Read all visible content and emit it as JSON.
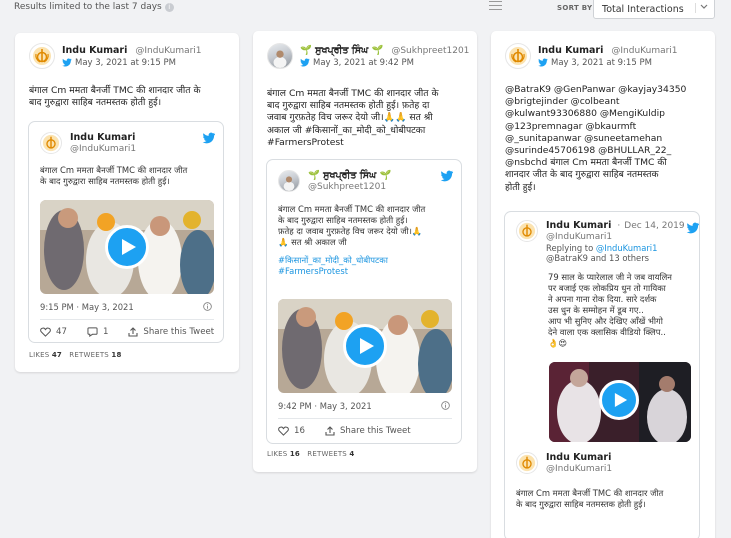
{
  "header": {
    "limit_text": "Results limited to the last 7 days",
    "sort_label": "SORT BY",
    "sort_value": "Total Interactions"
  },
  "colors": {
    "twitter_blue": "#1da1f2",
    "link": "#1b95e0",
    "background": "#f1f2f4"
  },
  "cards": [
    {
      "author": "Indu Kumari",
      "handle": "@InduKumari1",
      "date": "May 3, 2021 at 9:15 PM",
      "text_lines": [
        "बंगाल Cm ममता बैनर्जी TMC की शानदार जीत के",
        "बाद गुरुद्वारा साहिब नतमस्तक होती हुई।"
      ],
      "embed": {
        "author": "Indu Kumari",
        "handle": "@InduKumari1",
        "text_lines": [
          "बंगाल Cm ममता बैनर्जी TMC की शानदार जीत",
          "के बाद गुरुद्वारा साहिब नतमस्तक होती हुई।"
        ],
        "timestamp": "9:15 PM · May 3, 2021",
        "likes": "47",
        "replies": "1",
        "share": "Share this Tweet"
      },
      "stats": {
        "likes_label": "LIKES",
        "likes": "47",
        "retweets_label": "RETWEETS",
        "retweets": "18"
      }
    },
    {
      "author": "🌱 ਸੁਖਪ੍ਰੀਤ ਸਿੰਘ 🌱",
      "handle": "@Sukhpreet1201",
      "date": "May 3, 2021 at 9:42 PM",
      "text_lines": [
        "बंगाल Cm ममता बैनर्जी TMC की शानदार जीत के",
        "बाद गुरुद्वारा साहिब नतमस्तक होती हुई। फ़तेह दा",
        "जवाब गुरफ़तेह विच जरूर देयो जी।🙏🙏 सत श्री",
        "अकाल जी #किसानों_का_मोदी_को_धोबीपटका",
        "#FarmersProtest"
      ],
      "embed": {
        "author": "🌱 ਸੁਖਪ੍ਰੀਤ ਸਿੰਘ 🌱",
        "handle": "@Sukhpreet1201",
        "text_lines": [
          "बंगाल Cm ममता बैनर्जी TMC की शानदार जीत",
          "के बाद गुरुद्वारा साहिब नतमस्तक होती हुई।",
          "फ़तेह दा जवाब गुरफ़तेह विच जरूर देयो जी।🙏",
          "🙏 सत श्री अकाल जी"
        ],
        "hashtags": [
          "#किसानों_का_मोदी_को_धोबीपटका",
          "#FarmersProtest"
        ],
        "timestamp": "9:42 PM · May 3, 2021",
        "likes": "16",
        "share": "Share this Tweet"
      },
      "stats": {
        "likes_label": "LIKES",
        "likes": "16",
        "retweets_label": "RETWEETS",
        "retweets": "4"
      }
    },
    {
      "author": "Indu Kumari",
      "handle": "@InduKumari1",
      "date": "May 3, 2021 at 9:15 PM",
      "text_lines": [
        "@BatraK9 @GenPanwar @kayjay34350",
        "@brigtejinder @colbeant",
        "@kulwant93306880 @MengiKuldip",
        "@123premnagar @bkaurmft",
        "@_sunitapanwar @suneetamehan",
        "@surinde45706198 @BHULLAR_22_",
        "@nsbchd बंगाल Cm ममता बैनर्जी TMC की",
        "शानदार जीत के बाद गुरुद्वारा साहिब नतमस्तक",
        "होती हुई।"
      ],
      "embed": {
        "author": "Indu Kumari",
        "date": "Dec 14, 2019",
        "handle": "@InduKumari1",
        "replying_prefix": "Replying to",
        "replying_to": "@InduKumari1",
        "replying_others": "@BatraK9 and 13 others",
        "text_lines": [
          "79 साल के प्यारेलाल जी ने जब वायलिन",
          "पर बजाई एक लोकप्रिय धुन तो गायिका",
          "ने अपना गाना रोक दिया. सारे दर्शक",
          "उस धुन के सम्मोहन में डूब गए..",
          "आप भी सुनिए और देखिए आँखें भीगो",
          "देने वाला एक क्लासिक वीडियो क्लिप..",
          "👌😍"
        ]
      },
      "quoted": {
        "author": "Indu Kumari",
        "handle": "@InduKumari1",
        "text_lines": [
          "बंगाल Cm ममता बैनर्जी TMC की शानदार जीत",
          "के बाद गुरुद्वारा साहिब नतमस्तक होती हुई।"
        ]
      }
    }
  ]
}
